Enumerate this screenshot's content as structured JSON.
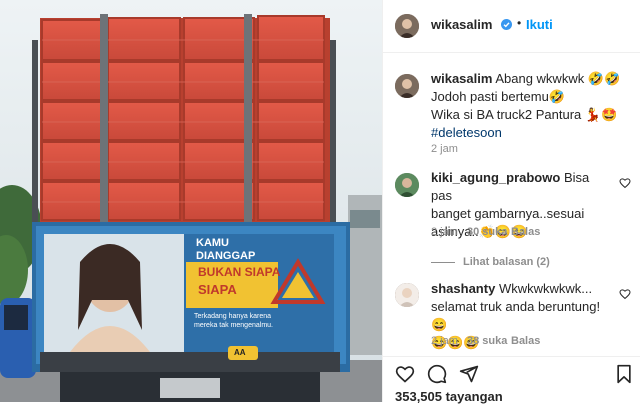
{
  "post": {
    "username": "wikasalim",
    "follow_label": "Ikuti",
    "separator": "•",
    "caption_lines": [
      "Abang wkwkwk 🤣🤣",
      "Jodoh pasti bertemu🤣",
      "Wika si BA truck2 Pantura 💃🤩",
      "#deletesoon"
    ],
    "caption_time": "2 jam"
  },
  "billboard": {
    "line1": "KAMU",
    "line2": "DIANGGAP",
    "line3": "BUKAN SIAPA",
    "line4": "SIAPA",
    "sub": "Terkadang hanya karena mereka tak mengenalmu.",
    "plate": "AA"
  },
  "comments": [
    {
      "username": "kiki_agung_prabowo",
      "lines": [
        "Bisa pas",
        "banget gambarnya..sesuai",
        "aslinya..👏😄😄"
      ],
      "time": "2 jam",
      "likes": "30 suka",
      "reply": "Balas",
      "view_replies": "Lihat balasan (2)"
    },
    {
      "username": "shashanty",
      "lines": [
        "Wkwkwkwkwk...",
        "selamat truk anda beruntung! 😄",
        "😄😄😄"
      ],
      "time": "2 jam",
      "likes": "38 suka",
      "reply": "Balas"
    }
  ],
  "footer": {
    "views": "353,505 tayangan"
  },
  "colors": {
    "accent": "#0095f6",
    "verified": "#3897f0",
    "muted": "#8e8e8e"
  }
}
